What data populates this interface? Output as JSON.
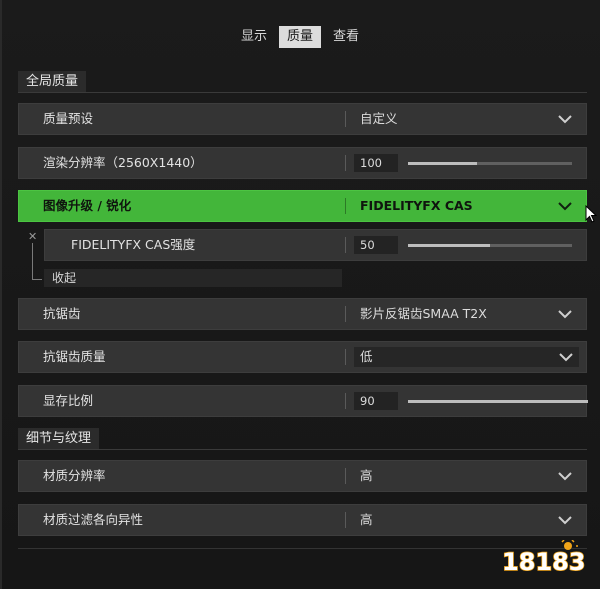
{
  "tabs": [
    {
      "label": "显示",
      "active": false
    },
    {
      "label": "质量",
      "active": true
    },
    {
      "label": "查看",
      "active": false
    }
  ],
  "sections": {
    "global": "全局质量",
    "detail": "细节与纹理"
  },
  "settings": {
    "quality_preset": {
      "name": "质量预设",
      "value": "自定义"
    },
    "render_resolution": {
      "name": "渲染分辨率（2560X1440）",
      "value": "100",
      "level_percent": 40
    },
    "upscaling": {
      "name": "图像升级 / 锐化",
      "value": "FIDELITYFX CAS"
    },
    "cas_strength": {
      "name": "FIDELITYFX CAS强度",
      "value": "50",
      "level_percent": 50
    },
    "collapse_label": "收起",
    "anti_aliasing": {
      "name": "抗锯齿",
      "value": "影片反锯齿SMAA T2X"
    },
    "aa_quality": {
      "name": "抗锯齿质量",
      "value": "低"
    },
    "vram_scale": {
      "name": "显存比例",
      "value": "90",
      "level_percent": 100
    },
    "texture_resolution": {
      "name": "材质分辨率",
      "value": "高"
    },
    "texture_filter": {
      "name": "材质过滤各向异性",
      "value": "高"
    }
  },
  "colors": {
    "accent_green": "#43b63a",
    "row_bg": "#343434",
    "page_bg": "#181818"
  },
  "watermark_text": "18183"
}
